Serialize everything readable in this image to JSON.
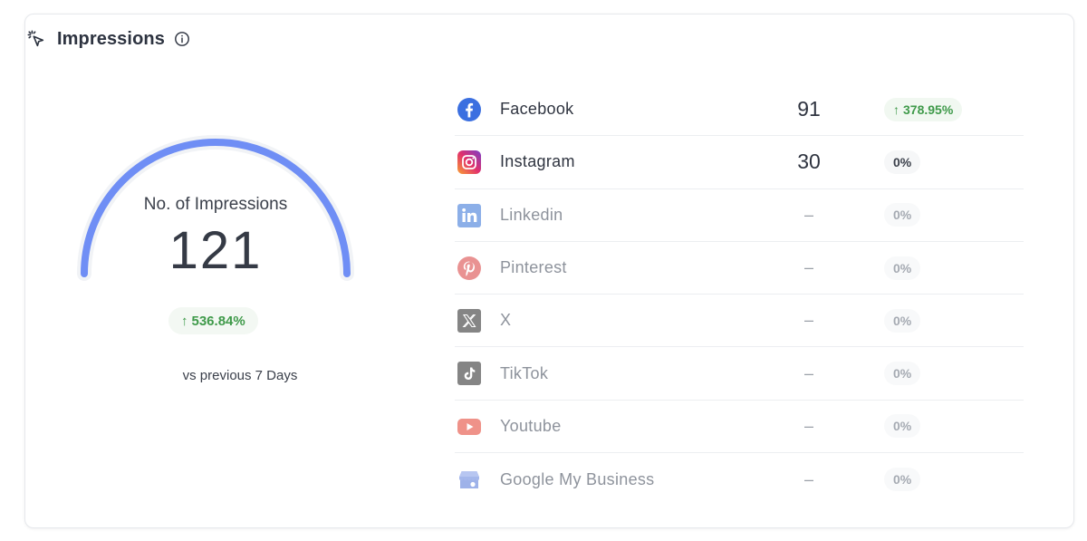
{
  "header": {
    "title": "Impressions",
    "cursor_icon": "cursor-click-icon",
    "info_icon": "info-circle-icon"
  },
  "summary": {
    "gauge_label": "No. of Impressions",
    "total": "121",
    "gauge_level": 1.0,
    "delta": "536.84%",
    "delta_direction": "up",
    "comparison": "vs previous 7 Days",
    "colors": {
      "gauge": "#6f8ef5",
      "positive": "#3f9a4a"
    }
  },
  "networks": [
    {
      "name": "Facebook",
      "icon": "facebook-icon",
      "count": "91",
      "delta": "378.95%",
      "trend": "up",
      "active": true,
      "color": "#3b6fe0"
    },
    {
      "name": "Instagram",
      "icon": "instagram-icon",
      "count": "30",
      "delta": "0%",
      "trend": "flat",
      "active": true,
      "color": "#d6308c"
    },
    {
      "name": "Linkedin",
      "icon": "linkedin-icon",
      "count": "–",
      "delta": "0%",
      "trend": "flat",
      "active": false,
      "color": "#2f6fd6"
    },
    {
      "name": "Pinterest",
      "icon": "pinterest-icon",
      "count": "–",
      "delta": "0%",
      "trend": "flat",
      "active": false,
      "color": "#d83a3a"
    },
    {
      "name": "X",
      "icon": "x-icon",
      "count": "–",
      "delta": "0%",
      "trend": "flat",
      "active": false,
      "color": "#222222"
    },
    {
      "name": "TikTok",
      "icon": "tiktok-icon",
      "count": "–",
      "delta": "0%",
      "trend": "flat",
      "active": false,
      "color": "#222222"
    },
    {
      "name": "Youtube",
      "icon": "youtube-icon",
      "count": "–",
      "delta": "0%",
      "trend": "flat",
      "active": false,
      "color": "#e23a2a"
    },
    {
      "name": "Google My Business",
      "icon": "google-my-business-icon",
      "count": "–",
      "delta": "0%",
      "trend": "flat",
      "active": false,
      "color": "#4f74d8"
    }
  ]
}
